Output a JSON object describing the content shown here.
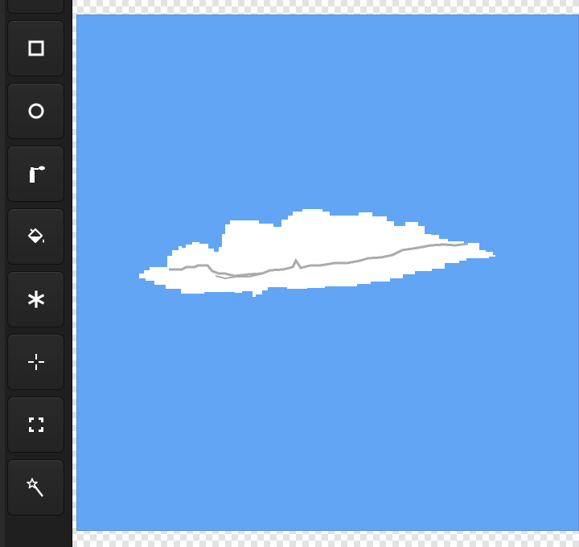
{
  "toolbar": {
    "tools": [
      {
        "name": "tool-partial",
        "icon": "unknown-tool-icon"
      },
      {
        "name": "rectangle",
        "icon": "square-icon"
      },
      {
        "name": "ellipse",
        "icon": "circle-icon"
      },
      {
        "name": "spray",
        "icon": "spray-can-icon"
      },
      {
        "name": "fill",
        "icon": "paint-bucket-icon"
      },
      {
        "name": "stamp",
        "icon": "asterisk-icon"
      },
      {
        "name": "move",
        "icon": "move-crosshair-icon"
      },
      {
        "name": "select",
        "icon": "selection-icon"
      },
      {
        "name": "magic-wand",
        "icon": "magic-wand-icon"
      }
    ]
  },
  "canvas": {
    "background_color": "#63a5f5",
    "cloud_color": "#ffffff",
    "cloud_shadow_color": "#ababab"
  },
  "colors": {
    "toolbar_bg": "#1f1f1f",
    "tool_button_bg": "#262626",
    "icon_color": "#ffffff"
  }
}
